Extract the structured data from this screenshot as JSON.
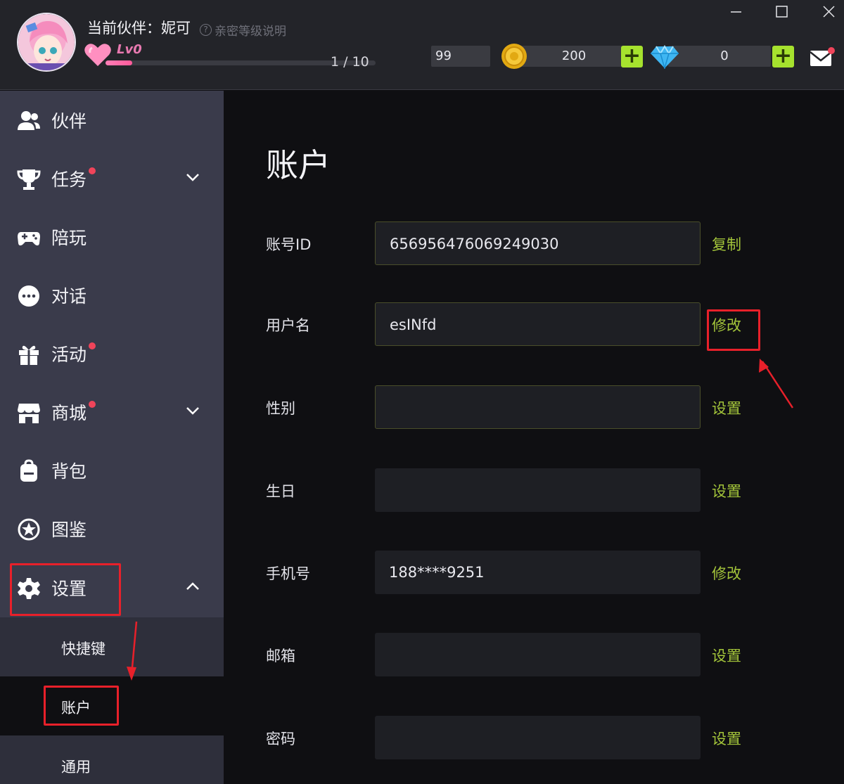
{
  "header": {
    "partner_title": "当前伙伴：妮可",
    "help_text": "亲密等级说明",
    "level": "Lv0",
    "progress_text": "1 / 10",
    "progress_fraction": 0.1,
    "stat_value": "99",
    "coins": "200",
    "gems": "0",
    "plus_symbol": "+"
  },
  "window": {
    "minimize": "minimize",
    "maximize": "maximize",
    "close": "close"
  },
  "sidebar": {
    "items": [
      {
        "label": "伙伴",
        "icon": "users-icon"
      },
      {
        "label": "任务",
        "icon": "trophy-icon"
      },
      {
        "label": "陪玩",
        "icon": "gamepad-icon"
      },
      {
        "label": "对话",
        "icon": "chat-icon"
      },
      {
        "label": "活动",
        "icon": "gift-icon"
      },
      {
        "label": "商城",
        "icon": "shop-icon"
      },
      {
        "label": "背包",
        "icon": "backpack-icon"
      },
      {
        "label": "图鉴",
        "icon": "star-badge-icon"
      },
      {
        "label": "设置",
        "icon": "gear-icon"
      }
    ],
    "settings_sub": [
      {
        "label": "快捷键"
      },
      {
        "label": "账户"
      },
      {
        "label": "通用"
      }
    ]
  },
  "main": {
    "title": "账户",
    "fields": [
      {
        "label": "账号ID",
        "value": "656956476069249030",
        "action": "复制"
      },
      {
        "label": "用户名",
        "value": "esINfd",
        "action": "修改"
      },
      {
        "label": "性别",
        "value": "",
        "action": "设置"
      },
      {
        "label": "生日",
        "value": "",
        "action": "设置"
      },
      {
        "label": "手机号",
        "value": "188****9251",
        "action": "修改"
      },
      {
        "label": "邮箱",
        "value": "",
        "action": "设置"
      },
      {
        "label": "密码",
        "value": "",
        "action": "设置"
      }
    ]
  },
  "colors": {
    "accent_green": "#a3c43a",
    "plus_green": "#a6e22e",
    "annotation_red": "#e8202a",
    "notification_red": "#f0445a",
    "sidebar_bg": "#3a3b4b"
  }
}
